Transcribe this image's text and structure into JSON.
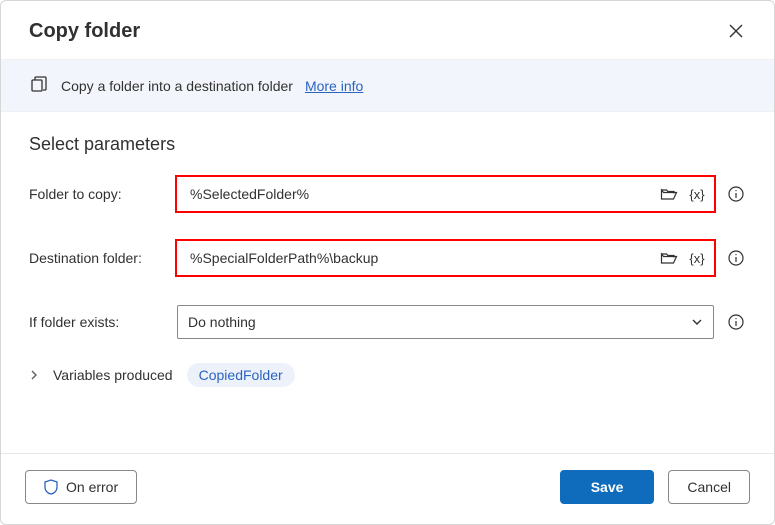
{
  "header": {
    "title": "Copy folder"
  },
  "description": {
    "text": "Copy a folder into a destination folder",
    "more_info": "More info"
  },
  "section_title": "Select parameters",
  "fields": {
    "folder_to_copy": {
      "label": "Folder to copy:",
      "value": "%SelectedFolder%"
    },
    "destination_folder": {
      "label": "Destination folder:",
      "value": "%SpecialFolderPath%\\backup"
    },
    "if_exists": {
      "label": "If folder exists:",
      "value": "Do nothing"
    }
  },
  "variables": {
    "label": "Variables produced",
    "chip": "CopiedFolder"
  },
  "footer": {
    "on_error": "On error",
    "save": "Save",
    "cancel": "Cancel"
  },
  "icons": {
    "var_token": "{x}"
  }
}
